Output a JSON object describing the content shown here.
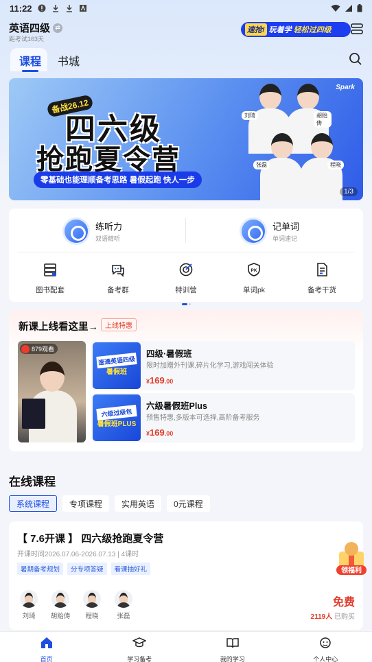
{
  "status_bar": {
    "time": "11:22"
  },
  "header": {
    "course": "英语四级",
    "exam_days": "距考试163天",
    "promo": {
      "flash": "速抢!",
      "text": "玩着学",
      "highlight": "轻松过四级"
    }
  },
  "tabs": [
    {
      "label": "课程",
      "active": true
    },
    {
      "label": "书城",
      "active": false
    }
  ],
  "banner": {
    "ribbon": "备战26.12",
    "line1": "四六级",
    "line2": "抢跑夏令营",
    "subtitle": "零基础也能理顺备考思路 暑假起跑 快人一步",
    "brand": "Spark",
    "counter": "1/3",
    "teachers": [
      "刘琦",
      "胡贻俦",
      "张磊",
      "程晓"
    ]
  },
  "quick_actions": [
    {
      "title": "练听力",
      "sub": "双语精听"
    },
    {
      "title": "记单词",
      "sub": "单词速记"
    }
  ],
  "grid": [
    {
      "label": "图书配套",
      "icon": "book-stack-icon"
    },
    {
      "label": "备考群",
      "icon": "chat-group-icon"
    },
    {
      "label": "特训营",
      "icon": "target-icon"
    },
    {
      "label": "单词pk",
      "icon": "pk-shield-icon"
    },
    {
      "label": "备考干货",
      "icon": "document-icon"
    }
  ],
  "new_courses": {
    "title": "新课上线看这里→",
    "badge": "上线特惠",
    "live_viewers": "879观看",
    "items": [
      {
        "title": "四级·暑假班",
        "desc": "限时加赠外刊课,碎片化学习,游戏闯关体验",
        "currency": "¥",
        "price": "169",
        "decimal": ".00",
        "thumb_line1": "速通英语四级",
        "thumb_line2": "暑假班"
      },
      {
        "title": "六级暑假班Plus",
        "desc": "预售特惠,多版本可选择,高阶备考服务",
        "currency": "¥",
        "price": "169",
        "decimal": ".00",
        "thumb_line1": "六级过级包",
        "thumb_line2": "暑假班PLUS"
      }
    ]
  },
  "online": {
    "title": "在线课程",
    "filters": [
      {
        "label": "系统课程",
        "active": true
      },
      {
        "label": "专项课程",
        "active": false
      },
      {
        "label": "实用英语",
        "active": false
      },
      {
        "label": "0元课程",
        "active": false
      }
    ],
    "course": {
      "title": "【 7.6开课 】 四六级抢跑夏令营",
      "time": "开课时间2026.07.06-2026.07.13 | 4课时",
      "tags": [
        "暑期备考规划",
        "分专项答疑",
        "看课抽好礼"
      ],
      "teachers": [
        "刘琦",
        "胡贻俦",
        "程晓",
        "张磊"
      ],
      "price": "免费",
      "bought_count": "2119人",
      "bought_suffix": " 已购买"
    },
    "gift_label": "领福利"
  },
  "bottom_nav": [
    {
      "label": "首页",
      "active": true
    },
    {
      "label": "学习备考",
      "active": false
    },
    {
      "label": "我的学习",
      "active": false
    },
    {
      "label": "个人中心",
      "active": false
    }
  ],
  "colors": {
    "accent": "#1e4fe0",
    "price": "#e23c2a"
  }
}
